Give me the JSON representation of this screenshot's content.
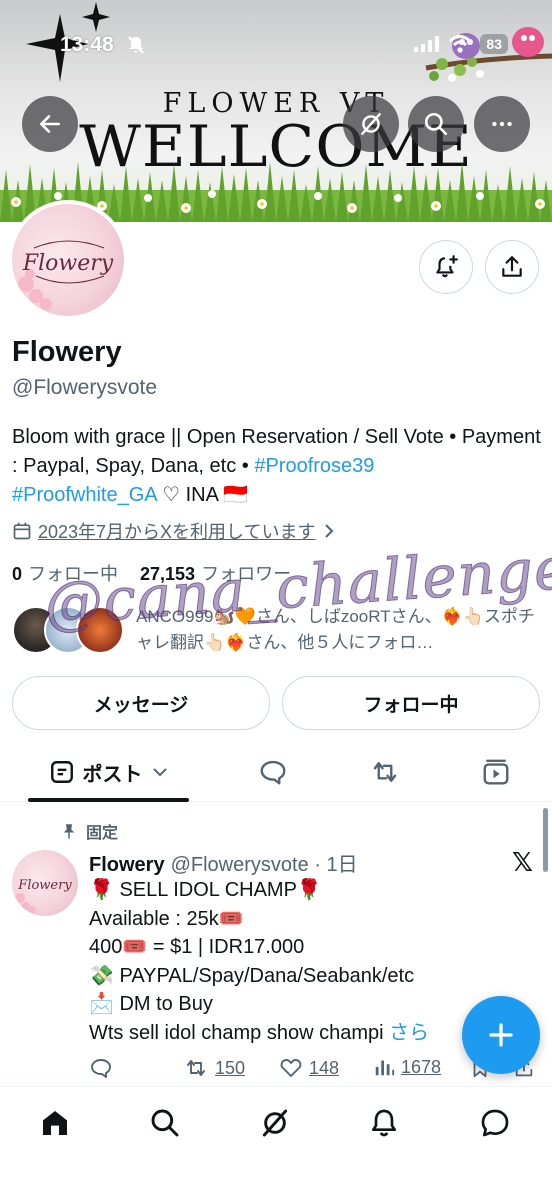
{
  "status_bar": {
    "time": "13:48",
    "battery": "83"
  },
  "banner": {
    "title_small": "FLOWER VT",
    "title_big": "WELLCOME"
  },
  "profile": {
    "avatar_text": "Flowery",
    "display_name": "Flowery",
    "handle": "@Flowerysvote",
    "bio_part1": "Bloom with grace || Open Reservation / Sell Vote • Payment : Paypal, Spay, Dana, etc • ",
    "bio_tag1": "#Proofrose39",
    "bio_tag2": "#Proofwhite_GA",
    "bio_part2": " ♡ INA 🇮🇩",
    "joined": "2023年7月からXを利用しています",
    "following_count": "0",
    "following_label": "フォロー中",
    "followers_count": "27,153",
    "followers_label": "フォロワー",
    "followed_by": "ANCO999🐿️🧡さん、しばzooRTさん、❤️‍🔥👆🏻スポチャレ翻訳👆🏻❤️‍🔥さん、他５人にフォロ…",
    "watermark": "@cana_challenge"
  },
  "actions": {
    "message_label": "メッセージ",
    "following_label": "フォロー中"
  },
  "tabs": {
    "posts_label": "ポスト"
  },
  "post": {
    "pinned_label": "固定",
    "name": "Flowery",
    "handle_time": "@Flowerysvote · 1日",
    "text": "🌹 SELL IDOL CHAMP🌹\nAvailable : 25k🎟️\n400🎟️ = $1 | IDR17.000\n💸 PAYPAL/Spay/Dana/Seabank/etc\n📩 DM to Buy\nWts sell idol champ show champi ",
    "more_label": "さら",
    "retweets": "150",
    "likes": "148",
    "views": "1678"
  },
  "colors": {
    "accent": "#1d9bf0",
    "text_primary": "#0f1419",
    "text_secondary": "#536471",
    "border": "#cfd9de"
  }
}
